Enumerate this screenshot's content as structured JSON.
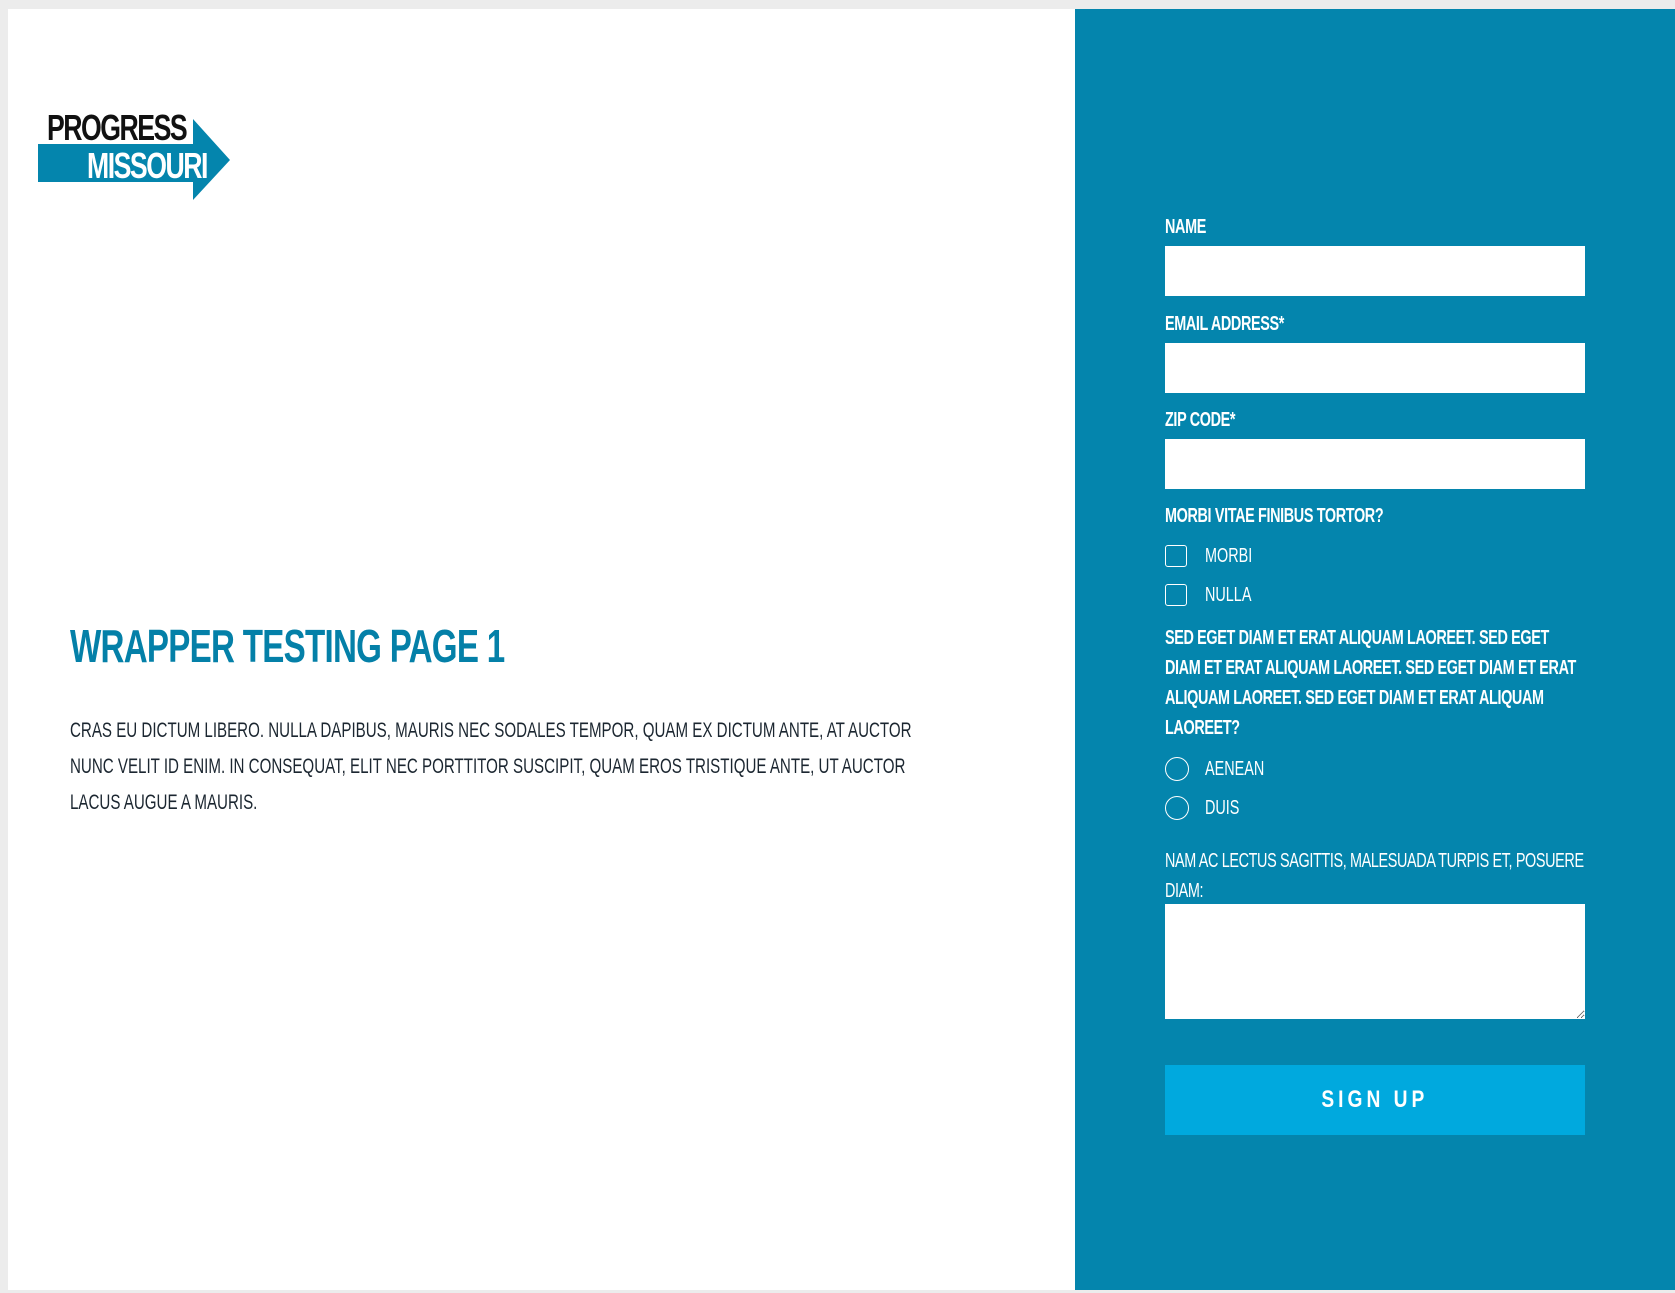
{
  "colors": {
    "brand_blue": "#0485ad",
    "button_blue": "#00a9de",
    "title_blue": "#0480a8",
    "body_text": "#1b2630",
    "page_background": "#ececec"
  },
  "logo": {
    "line1": "PROGRESS",
    "line2": "MISSOURI",
    "icon": "arrow-icon"
  },
  "content": {
    "title": "WRAPPER TESTING PAGE 1",
    "body": "CRAS EU DICTUM LIBERO. NULLA DAPIBUS, MAURIS NEC SODALES TEMPOR, QUAM EX DICTUM ANTE, AT AUCTOR NUNC VELIT ID ENIM. IN CONSEQUAT, ELIT NEC PORTTITOR SUSCIPIT, QUAM EROS TRISTIQUE ANTE, UT AUCTOR LACUS AUGUE A MAURIS."
  },
  "form": {
    "name_label": "NAME",
    "name_value": "",
    "email_label": "EMAIL ADDRESS*",
    "email_value": "",
    "zip_label": "ZIP CODE*",
    "zip_value": "",
    "checkbox_question": "MORBI VITAE FINIBUS TORTOR?",
    "checkbox_options": [
      {
        "label": "MORBI",
        "checked": false
      },
      {
        "label": "NULLA",
        "checked": false
      }
    ],
    "radio_question": "SED EGET DIAM ET ERAT ALIQUAM LAOREET. SED EGET DIAM ET ERAT ALIQUAM LAOREET. SED EGET DIAM ET ERAT ALIQUAM LAOREET. SED EGET DIAM ET ERAT ALIQUAM LAOREET?",
    "radio_options": [
      {
        "label": "AENEAN",
        "selected": false
      },
      {
        "label": "DUIS",
        "selected": false
      }
    ],
    "textarea_label": "NAM AC LECTUS SAGITTIS, MALESUADA TURPIS ET, POSUERE DIAM:",
    "textarea_value": "",
    "submit_label": "SIGN UP"
  }
}
